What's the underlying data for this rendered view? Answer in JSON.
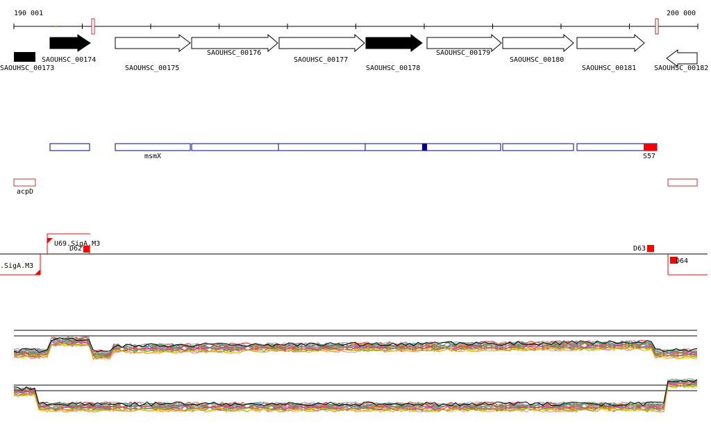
{
  "coordinates": {
    "start_label": "190 001",
    "end_label": "200 000"
  },
  "colors": {
    "accent_red": "#ff0000",
    "outline_red": "#cc3333",
    "region_blue": "#00008b",
    "axis": "#000000",
    "background": "#ffffff"
  },
  "genes": {
    "g173": "SAOUHSC_00173",
    "g174": "SAOUHSC_00174",
    "g175": "SAOUHSC_00175",
    "g176": "SAOUHSC_00176",
    "g177": "SAOUHSC_00177",
    "g178": "SAOUHSC_00178",
    "g179": "SAOUHSC_00179",
    "g180": "SAOUHSC_00180",
    "g181": "SAOUHSC_00181",
    "g182": "SAOUHSC_00182"
  },
  "regions": {
    "msmx_label": "msmX",
    "s57_label": "S57"
  },
  "features": {
    "acpd_label": "acpD"
  },
  "promoters": {
    "u69": "U69.SigA.M3",
    "left_partial": ".SigA.M3",
    "d62": "D62",
    "d63": "D63",
    "d64": "D64"
  },
  "tracks": {
    "upper_icon": "expression-profile-track",
    "lower_icon": "expression-profile-track",
    "line_colors": [
      "#e41a1c",
      "#377eb8",
      "#4daf4a",
      "#984ea3",
      "#ff7f00",
      "#a65628",
      "#f781bf",
      "#999999",
      "#66c2a5",
      "#fc8d62",
      "#8da0cb",
      "#e78ac3",
      "#a6d854",
      "#ffd92f",
      "#b3b3b3",
      "#1b9e77",
      "#d95f02",
      "#7570b3",
      "#e7298a",
      "#66a61e",
      "#e6ab02",
      "#000000"
    ]
  }
}
